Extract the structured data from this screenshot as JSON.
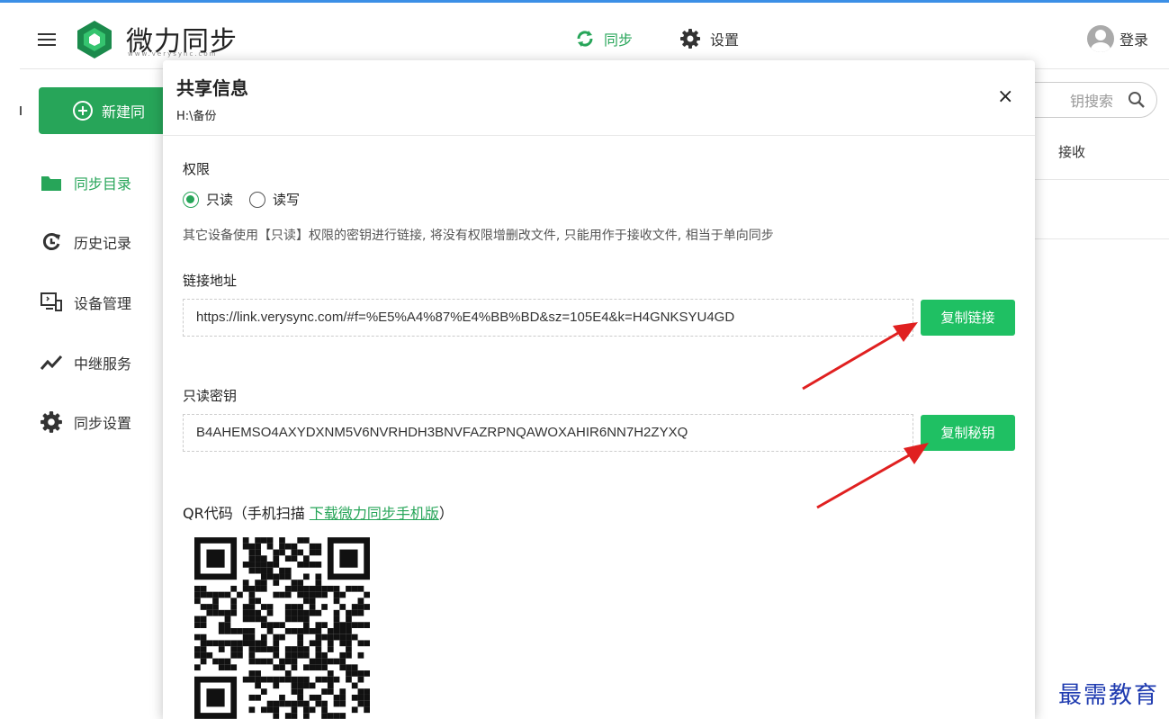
{
  "app": {
    "logo_text": "微力同步",
    "logo_sub": "www.verysync.com",
    "nav_sync": "同步",
    "nav_settings": "设置",
    "login": "登录",
    "new_button": "新建同",
    "search_placeholder": "钥搜索",
    "column_receive": "接收",
    "watermark": "最需教育",
    "sidebar": [
      {
        "label": "同步目录",
        "icon": "folder-icon"
      },
      {
        "label": "历史记录",
        "icon": "history-icon"
      },
      {
        "label": "设备管理",
        "icon": "device-icon"
      },
      {
        "label": "中继服务",
        "icon": "relay-icon"
      },
      {
        "label": "同步设置",
        "icon": "gear-icon"
      }
    ],
    "accent_color": "#27a559"
  },
  "modal": {
    "title": "共享信息",
    "path": "H:\\备份",
    "close": "×",
    "permission_label": "权限",
    "radio_readonly": "只读",
    "radio_readwrite": "读写",
    "hint": "其它设备使用【只读】权限的密钥进行链接, 将没有权限增删改文件, 只能用作于接收文件, 相当于单向同步",
    "link_label": "链接地址",
    "link_value": "https://link.verysync.com/#f=%E5%A4%87%E4%BB%BD&sz=105E4&k=H4GNKSYU4GD",
    "copy_link": "复制链接",
    "key_label": "只读密钥",
    "key_value": "B4AHEMSO4AXYDXNM5V6NVRHDH3BNVFAZRPNQAWOXAHIR6NN7H2ZYXQ",
    "copy_key": "复制秘钥",
    "qr_label": "QR代码（手机扫描 ",
    "qr_link": "下载微力同步手机版",
    "qr_label_end": "）"
  }
}
